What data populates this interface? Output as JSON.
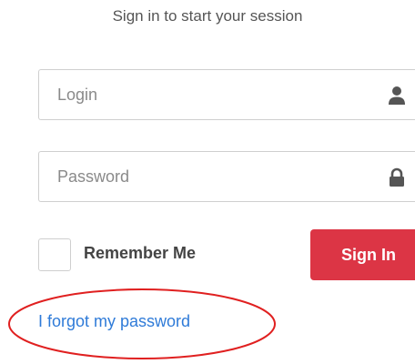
{
  "session_message": "Sign in to start your session",
  "login": {
    "placeholder": "Login",
    "value": "",
    "icon": "user-icon"
  },
  "password": {
    "placeholder": "Password",
    "value": "",
    "icon": "lock-icon"
  },
  "remember_me": {
    "label": "Remember Me",
    "checked": false
  },
  "sign_in_button": {
    "label": "Sign In",
    "color": "#dc3545"
  },
  "forgot_password_link": {
    "label": "I forgot my password",
    "color": "#2f7bd8"
  },
  "annotation": {
    "shape": "ellipse",
    "color": "#e02020",
    "target": "forgot_password_link"
  }
}
